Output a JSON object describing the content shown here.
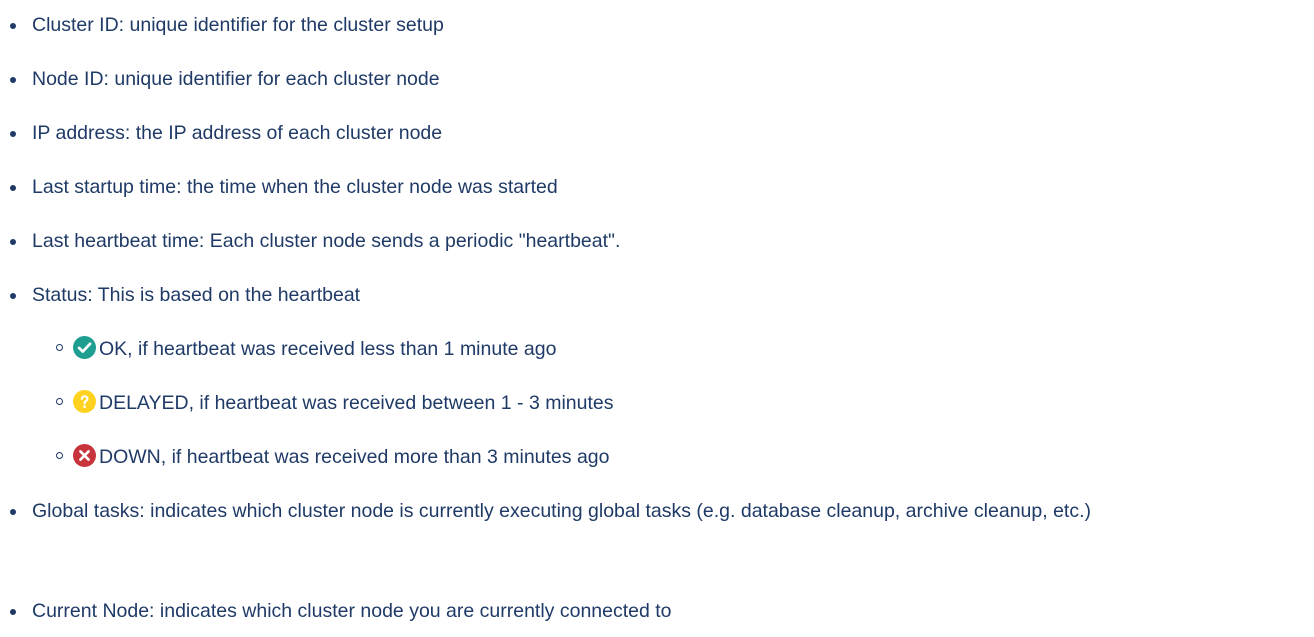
{
  "items": [
    {
      "text": "Cluster ID: unique identifier for the cluster setup"
    },
    {
      "text": "Node ID: unique identifier for each cluster node"
    },
    {
      "text": "IP address: the IP address of each cluster node"
    },
    {
      "text": "Last startup time: the time when the cluster node was started"
    },
    {
      "text": "Last heartbeat time: Each cluster node sends a periodic \"heartbeat\"."
    },
    {
      "text": "Status: This is based on the heartbeat"
    },
    {
      "text": "Global tasks: indicates which cluster node is currently executing global tasks (e.g. database cleanup, archive cleanup, etc.)"
    },
    {
      "text": "Current Node: indicates which cluster node you are currently connected to"
    }
  ],
  "status_levels": [
    {
      "icon": "check-circle-icon",
      "color": "#1e9e8f",
      "text": "OK, if heartbeat was received less than 1 minute ago"
    },
    {
      "icon": "question-circle-icon",
      "color": "#ffd21f",
      "text": "DELAYED, if heartbeat was received between 1 - 3 minutes"
    },
    {
      "icon": "x-circle-icon",
      "color": "#c8343c",
      "text": "DOWN, if heartbeat was received more than 3 minutes ago"
    }
  ]
}
